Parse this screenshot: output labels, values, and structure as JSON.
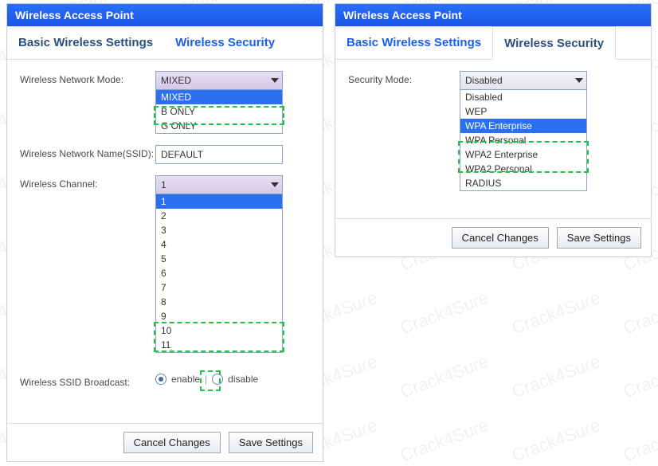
{
  "watermark_text": "Crack4Sure",
  "left": {
    "title": "Wireless Access Point",
    "tab_basic": "Basic Wireless Settings",
    "tab_security": "Wireless Security",
    "mode_label": "Wireless Network Mode:",
    "mode_selected": "MIXED",
    "mode_options": [
      "MIXED",
      "B ONLY",
      "G ONLY"
    ],
    "ssid_label": "Wireless Network Name(SSID):",
    "ssid_value": "DEFAULT",
    "channel_label": "Wireless Channel:",
    "channel_selected": "1",
    "channel_options": [
      "1",
      "2",
      "3",
      "4",
      "5",
      "6",
      "7",
      "8",
      "9",
      "10",
      "11"
    ],
    "broadcast_label": "Wireless SSID Broadcast:",
    "broadcast_enable": "enable",
    "broadcast_disable": "disable",
    "cancel": "Cancel Changes",
    "save": "Save Settings"
  },
  "right": {
    "title": "Wireless Access Point",
    "tab_basic": "Basic Wireless Settings",
    "tab_security": "Wireless Security",
    "secmode_label": "Security Mode:",
    "secmode_selected": "Disabled",
    "secmode_options": [
      "Disabled",
      "WEP",
      "WPA Enterprise",
      "WPA Personal",
      "WPA2 Enterprise",
      "WPA2 Personal",
      "RADIUS"
    ],
    "secmode_highlight": "WPA Enterprise",
    "cancel": "Cancel Changes",
    "save": "Save Settings"
  }
}
